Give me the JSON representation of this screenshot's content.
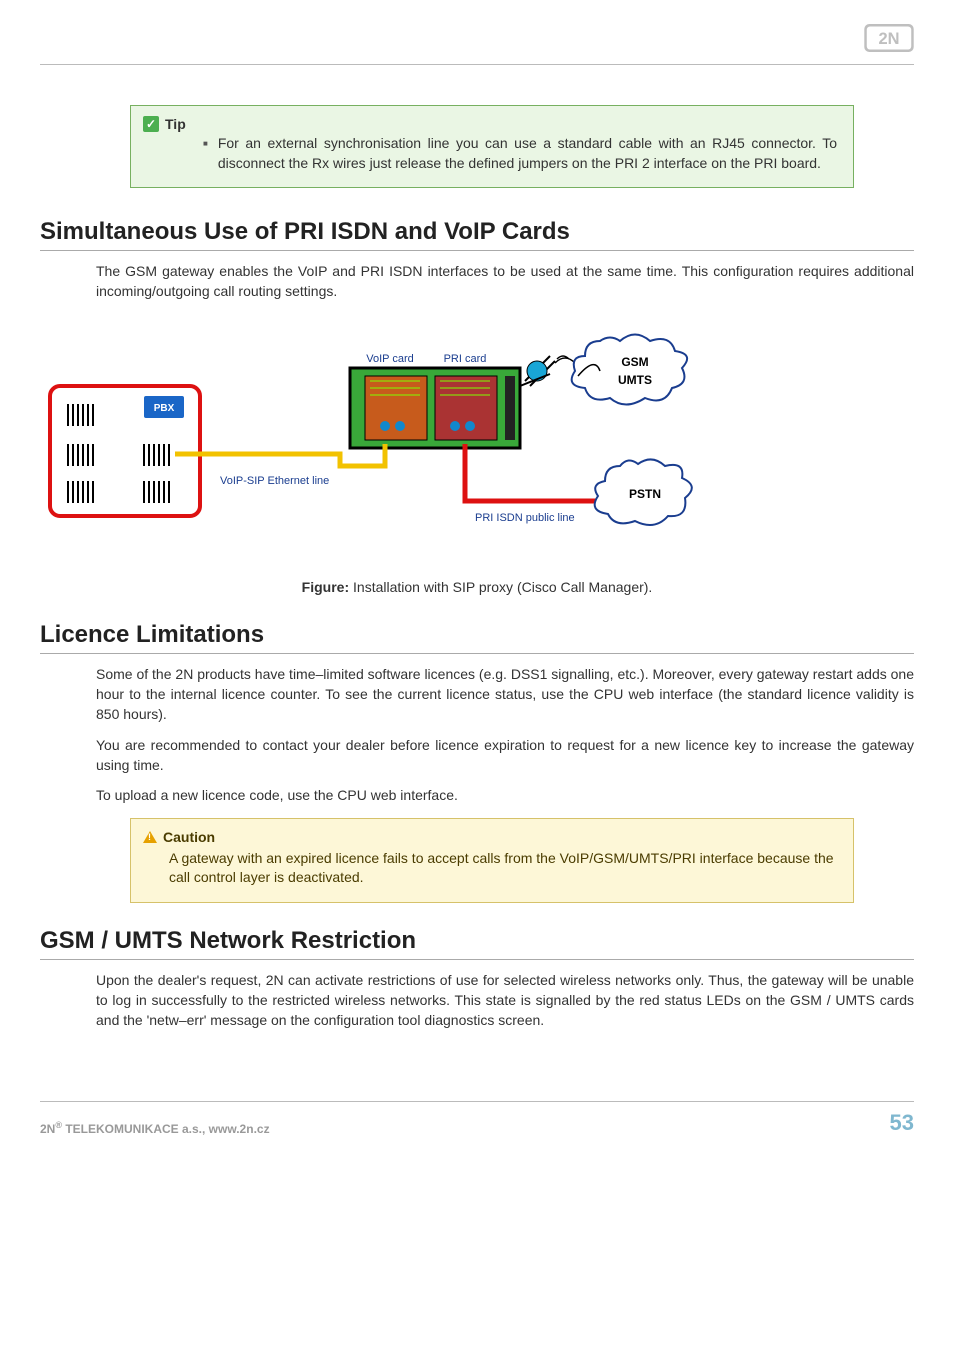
{
  "header": {
    "brand": "2N"
  },
  "tip": {
    "label": "Tip",
    "text": "For an external synchronisation line you can use a standard cable with an RJ45 connector. To disconnect the Rx wires just release the defined jumpers on the PRI 2 interface on the PRI board."
  },
  "section1": {
    "title": "Simultaneous Use of PRI ISDN and VoIP Cards",
    "p1": "The GSM gateway enables the VoIP and PRI ISDN interfaces to be used at the same time. This configuration requires additional incoming/outgoing call routing settings.",
    "diagram": {
      "voip_card": "VoIP card",
      "pri_card": "PRI card",
      "voip_line": "VoIP-SIP Ethernet line",
      "pri_line": "PRI ISDN public line",
      "pbx": "PBX",
      "gsm": "GSM",
      "umts": "UMTS",
      "pstn": "PSTN"
    },
    "figure_label": "Figure:",
    "figure_text": " Installation with SIP proxy (Cisco Call Manager)."
  },
  "section2": {
    "title": "Licence Limitations",
    "p1": "Some of the 2N products have time–limited software licences (e.g. DSS1 signalling, etc.). Moreover, every gateway restart adds one hour to the internal licence counter. To see the current licence status, use the CPU web interface (the standard licence validity is 850 hours).",
    "p2": "You are recommended to contact your dealer before licence expiration to request for a new licence key to increase the gateway using time.",
    "p3": "To upload a new licence code, use the CPU web interface.",
    "caution": {
      "label": "Caution",
      "text": " A gateway with an expired licence fails to accept calls from the VoIP/GSM/UMTS/PRI interface because the call control layer is deactivated."
    }
  },
  "section3": {
    "title": "GSM / UMTS Network Restriction",
    "p1": "Upon the dealer's request, 2N can activate restrictions of use for selected wireless networks only. Thus, the gateway will be unable to log in successfully to the restricted wireless networks. This state is signalled by the red status LEDs on the GSM / UMTS cards and the 'netw–err' message on the configuration tool diagnostics screen."
  },
  "footer": {
    "company": "2N® TELEKOMUNIKACE a.s., www.2n.cz",
    "page": "53"
  }
}
